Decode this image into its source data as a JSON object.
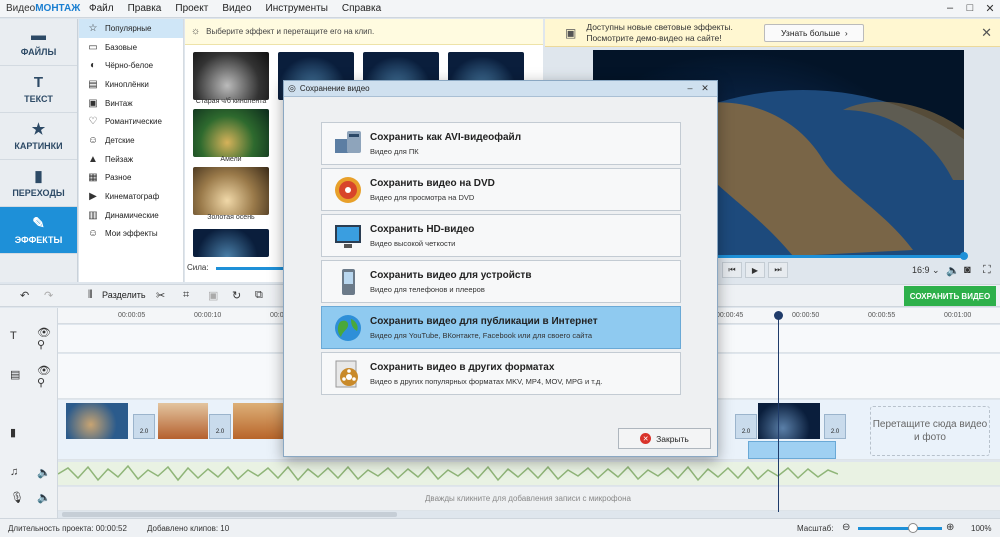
{
  "app": {
    "title_prefix": "Видео",
    "title_brand": "МОНТАЖ"
  },
  "menu": [
    "Файл",
    "Правка",
    "Проект",
    "Видео",
    "Инструменты",
    "Справка"
  ],
  "window_buttons": [
    "–",
    "□",
    "✕"
  ],
  "nav": [
    {
      "label": "ФАЙЛЫ",
      "icon": "file-icon"
    },
    {
      "label": "ТЕКСТ",
      "icon": "text-icon"
    },
    {
      "label": "КАРТИНКИ",
      "icon": "star-icon"
    },
    {
      "label": "ПЕРЕХОДЫ",
      "icon": "transitions-icon"
    },
    {
      "label": "ЭФФЕКТЫ",
      "icon": "effects-icon"
    }
  ],
  "categories": [
    {
      "label": "Популярные",
      "glyph": "☆"
    },
    {
      "label": "Базовые",
      "glyph": "▭"
    },
    {
      "label": "Чёрно-белое",
      "glyph": "◐"
    },
    {
      "label": "Киноплёнки",
      "glyph": "▤"
    },
    {
      "label": "Винтаж",
      "glyph": "▣"
    },
    {
      "label": "Романтические",
      "glyph": "♡"
    },
    {
      "label": "Детские",
      "glyph": "☺"
    },
    {
      "label": "Пейзаж",
      "glyph": "▲"
    },
    {
      "label": "Разное",
      "glyph": "▦"
    },
    {
      "label": "Кинематограф",
      "glyph": "▶"
    },
    {
      "label": "Динамические",
      "glyph": "▥"
    },
    {
      "label": "Мои эффекты",
      "glyph": "☺"
    }
  ],
  "effects": {
    "hint": "Выберите эффект и перетащите его на клип.",
    "thumbs": [
      "Старая ч/б кинолента",
      "Амели",
      "Золотая осень"
    ],
    "strength_label": "Сила:"
  },
  "notice": {
    "text": "Доступны новые световые эффекты. Посмотрите демо-видео на сайте!",
    "button": "Узнать больше"
  },
  "player": {
    "ratio": "16:9 ⌄",
    "save_button": "СОХРАНИТЬ ВИДЕО"
  },
  "toolbar": {
    "split": "Разделить"
  },
  "timeline": {
    "ticks": [
      "00:00:05",
      "00:00:10",
      "00:00:15",
      "00:00:45",
      "00:00:50",
      "00:00:55",
      "00:01:00"
    ],
    "clip_badge": "2.0",
    "drop_zone": "Перетащите сюда видео и фото",
    "mic_hint": "Дважды кликните для добавления записи с микрофона"
  },
  "status": {
    "duration": "Длительность проекта:  00:00:52",
    "clips": "Добавлено клипов: 10",
    "zoom_label": "Масштаб:",
    "zoom_value": "100%"
  },
  "dialog": {
    "title": "Сохранение видео",
    "options": [
      {
        "title": "Сохранить как AVI-видеофайл",
        "desc": "Видео для ПК",
        "icon": "pc-icon"
      },
      {
        "title": "Сохранить видео на DVD",
        "desc": "Видео для просмотра на DVD",
        "icon": "dvd-icon"
      },
      {
        "title": "Сохранить HD-видео",
        "desc": "Видео высокой четкости",
        "icon": "monitor-icon"
      },
      {
        "title": "Сохранить видео для устройств",
        "desc": "Видео для телефонов и плееров",
        "icon": "phone-icon"
      },
      {
        "title": "Сохранить видео для публикации в Интернет",
        "desc": "Видео для YouTube, ВКонтакте, Facebook или для своего сайта",
        "icon": "globe-icon"
      },
      {
        "title": "Сохранить видео в других форматах",
        "desc": "Видео в других популярных форматах MKV, MP4, MOV, MPG и т.д.",
        "icon": "film-reel-icon"
      }
    ],
    "close_button": "Закрыть"
  }
}
